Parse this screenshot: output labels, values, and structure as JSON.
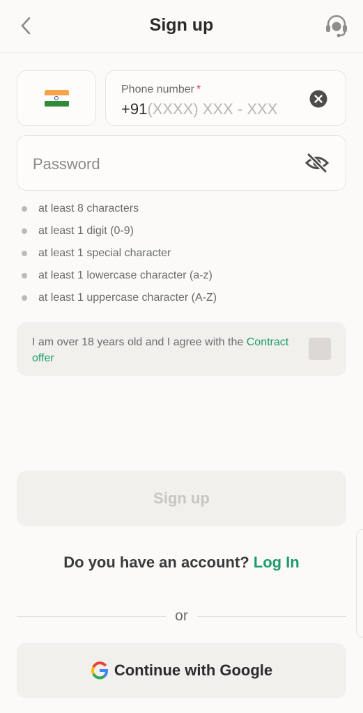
{
  "header": {
    "title": "Sign up",
    "back_icon": "chevron-left-icon",
    "support_icon": "headset-support-icon"
  },
  "country": {
    "flag": "india-flag-icon"
  },
  "phone": {
    "label": "Phone number",
    "required_mark": "*",
    "prefix": "+91",
    "placeholder": "(XXXX) XXX - XXX",
    "clear_icon": "clear-circle-icon"
  },
  "password": {
    "placeholder": "Password",
    "visibility_icon": "eye-off-icon"
  },
  "password_rules": [
    "at least 8 characters",
    "at least 1 digit (0-9)",
    "at least 1 special character",
    "at least 1 lowercase character (a-z)",
    "at least 1 uppercase character (A-Z)"
  ],
  "agreement": {
    "text": "I am over 18 years old and I agree with the",
    "link": "Contract offer",
    "checked": false
  },
  "signup_button": "Sign up",
  "account_prompt": {
    "text": "Do you have an account?",
    "link": "Log In"
  },
  "divider_text": "or",
  "google_button": "Continue with Google",
  "colors": {
    "accent_green": "#1d9b6a",
    "background": "#fbfaf9",
    "panel": "#f1f0ed",
    "required": "#e03c3c"
  }
}
